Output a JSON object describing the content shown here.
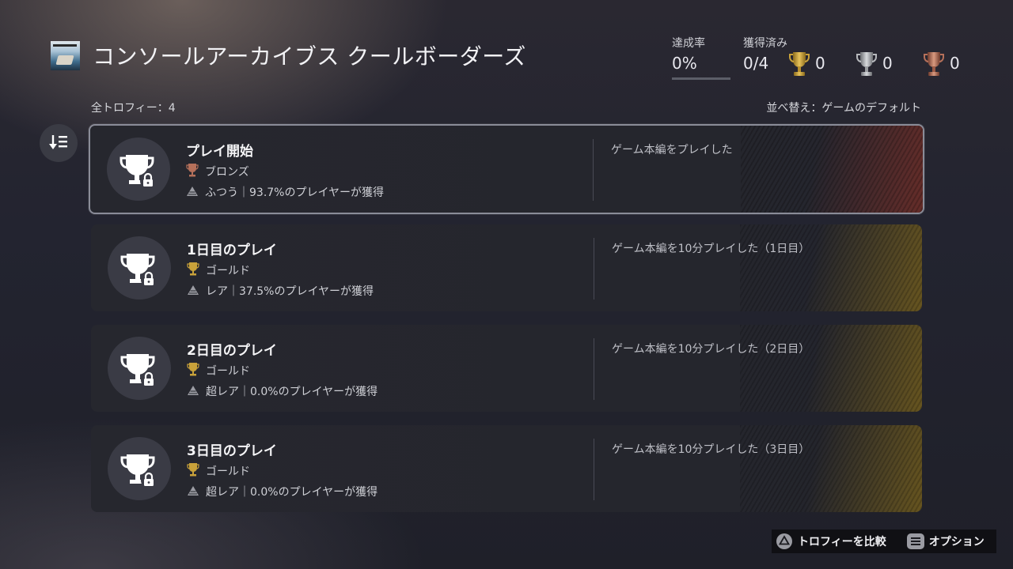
{
  "header": {
    "title": "コンソールアーカイブス クールボーダーズ",
    "completion_label": "達成率",
    "completion_value": "0%",
    "earned_label": "獲得済み",
    "earned_value": "0/4",
    "gold_count": "0",
    "silver_count": "0",
    "bronze_count": "0"
  },
  "list": {
    "total_label": "全トロフィー：4",
    "sort_label": "並べ替え：ゲームのデフォルト"
  },
  "trophies": [
    {
      "name": "プレイ開始",
      "grade": "ブロンズ",
      "rarity": "ふつう｜93.7%のプレイヤーが獲得",
      "description": "ゲーム本編をプレイした"
    },
    {
      "name": "1日目のプレイ",
      "grade": "ゴールド",
      "rarity": "レア｜37.5%のプレイヤーが獲得",
      "description": "ゲーム本編を10分プレイした（1日目）"
    },
    {
      "name": "2日目のプレイ",
      "grade": "ゴールド",
      "rarity": "超レア｜0.0%のプレイヤーが獲得",
      "description": "ゲーム本編を10分プレイした（2日目）"
    },
    {
      "name": "3日目のプレイ",
      "grade": "ゴールド",
      "rarity": "超レア｜0.0%のプレイヤーが獲得",
      "description": "ゲーム本編を10分プレイした（3日目）"
    }
  ],
  "footer": {
    "compare_label": "トロフィーを比較",
    "options_label": "オプション"
  },
  "colors": {
    "gold": "#c9a23a",
    "silver": "#b7b9bd",
    "bronze": "#b5705a"
  }
}
